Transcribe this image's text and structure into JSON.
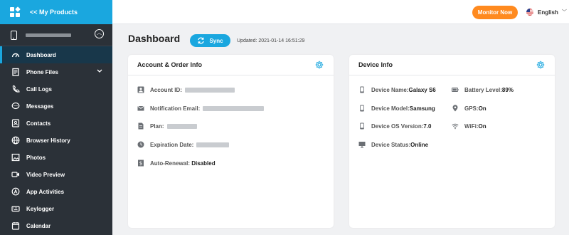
{
  "sidebar": {
    "back_label": "<< My Products",
    "items": [
      {
        "label": "Dashboard",
        "icon": "gauge-icon"
      },
      {
        "label": "Phone Files",
        "icon": "files-icon"
      },
      {
        "label": "Call Logs",
        "icon": "phone-call-icon"
      },
      {
        "label": "Messages",
        "icon": "chat-icon"
      },
      {
        "label": "Contacts",
        "icon": "contacts-icon"
      },
      {
        "label": "Browser History",
        "icon": "globe-icon"
      },
      {
        "label": "Photos",
        "icon": "image-icon"
      },
      {
        "label": "Video Preview",
        "icon": "video-icon"
      },
      {
        "label": "App Activities",
        "icon": "app-icon"
      },
      {
        "label": "Keylogger",
        "icon": "keyboard-icon"
      },
      {
        "label": "Calendar",
        "icon": "calendar-icon"
      }
    ],
    "active_index": 0
  },
  "topbar": {
    "monitor_label": "Monitor Now",
    "language": "English"
  },
  "main": {
    "title": "Dashboard",
    "sync_label": "Sync",
    "updated": "Updated: 2021-01-14 16:51:29"
  },
  "account_card": {
    "title": "Account & Order Info",
    "account_id_label": "Account ID:",
    "email_label": "Notification Email:",
    "plan_label": "Plan:",
    "expiration_label": "Expiration Date:",
    "renewal_label": "Auto-Renewal:",
    "renewal_value": "Disabled"
  },
  "device_card": {
    "title": "Device Info",
    "name_label": "Device Name:",
    "name_value": "Galaxy S6",
    "model_label": "Device Model:",
    "model_value": "Samsung",
    "os_label": "Device OS Version:",
    "os_value": "7.0",
    "status_label": "Device Status:",
    "status_value": "Online",
    "battery_label": "Battery Level:",
    "battery_value": "89%",
    "gps_label": "GPS:",
    "gps_value": "On",
    "wifi_label": "WiFi:",
    "wifi_value": "On"
  },
  "colors": {
    "accent": "#1aa7df",
    "sidebar_bg": "#2b3138",
    "monitor_orange": "#ff8a1f"
  }
}
